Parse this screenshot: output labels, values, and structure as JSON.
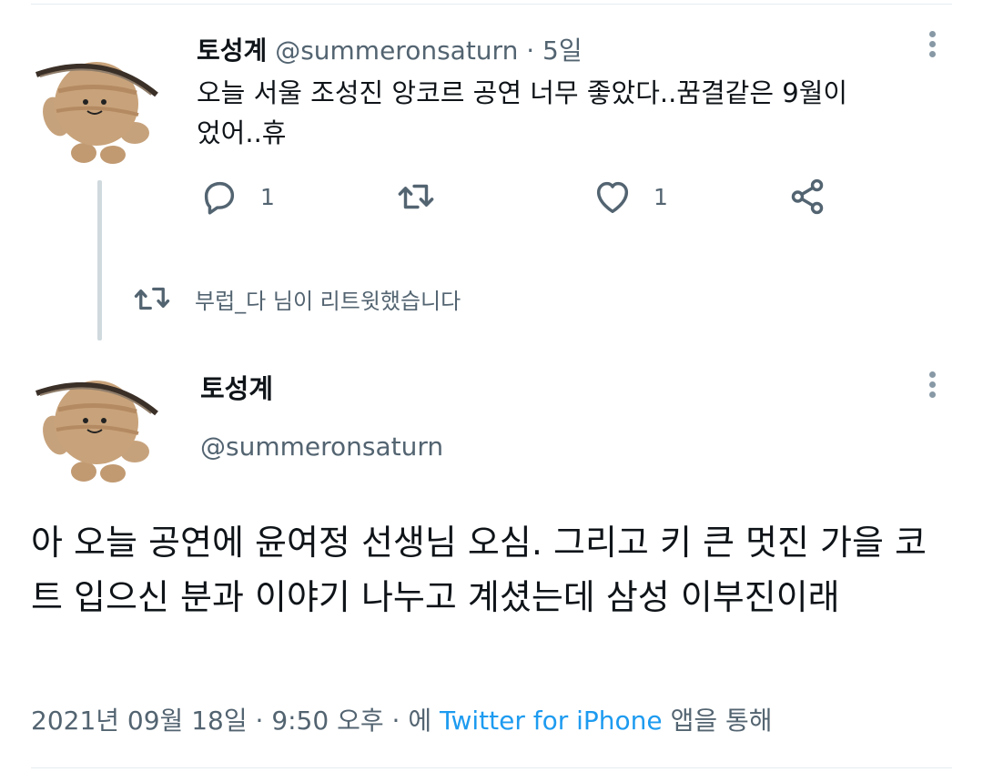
{
  "tweet1": {
    "name": "토성계",
    "handle": "@summeronsaturn",
    "dot": " · ",
    "time": "5일",
    "text": "오늘 서울 조성진 앙코르 공연 너무 좋았다..꿈결같은 9월이었어..휴",
    "reply_count": "1",
    "like_count": "1"
  },
  "retweet_notice": "부럽_다 님이 리트윗했습니다",
  "tweet2": {
    "name": "토성계",
    "handle": "@summeronsaturn",
    "text": "아 오늘 공연에 윤여정 선생님 오심. 그리고 키 큰 멋진 가을 코트 입으신 분과 이야기 나누고 계셨는데 삼성 이부진이래",
    "date": "2021년 09월 18일",
    "sep1": " · ",
    "time": "9:50 오후",
    "sep2": " · 에 ",
    "source": "Twitter for iPhone",
    "suffix": " 앱을 통해"
  },
  "icons": [
    "reply-icon",
    "retweet-icon",
    "like-icon",
    "share-icon",
    "more-icon"
  ],
  "colors": {
    "accent": "#1d9bf0",
    "secondary_text": "#536471",
    "primary_text": "#0f1419"
  }
}
